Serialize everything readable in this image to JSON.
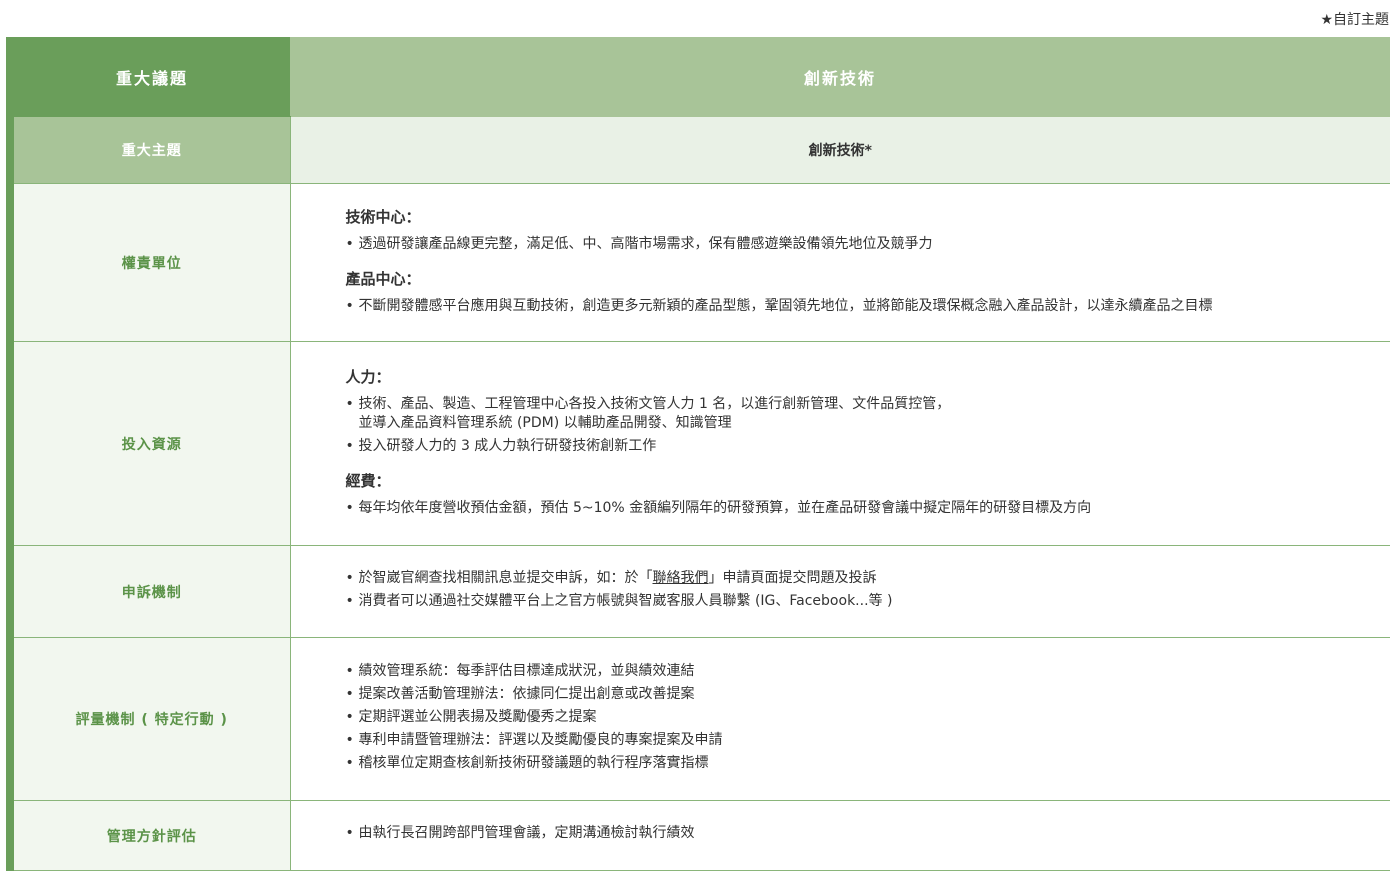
{
  "note": "★自訂主題",
  "header": {
    "left": "重大議題",
    "right": "創新技術"
  },
  "topic": {
    "left": "重大主題",
    "right": "創新技術*"
  },
  "responsible": {
    "label": "權責單位",
    "groups": [
      {
        "title": "技術中心：",
        "items": [
          "透過研發讓產品線更完整，滿足低、中、高階市場需求，保有體感遊樂設備領先地位及競爭力"
        ]
      },
      {
        "title": "產品中心：",
        "items": [
          "不斷開發體感平台應用與互動技術，創造更多元新穎的產品型態，鞏固領先地位，並將節能及環保概念融入產品設計，以達永續產品之目標"
        ]
      }
    ]
  },
  "investment": {
    "label": "投入資源",
    "groups": [
      {
        "title": "人力：",
        "items": [
          "技術、產品、製造、工程管理中心各投入技術文管人力 1 名，以進行創新管理、文件品質控管，",
          "並導入產品資料管理系統 (PDM) 以輔助產品開發、知識管理",
          "投入研發人力的 3 成人力執行研發技術創新工作"
        ]
      },
      {
        "title": "經費：",
        "items": [
          "每年均依年度營收預估金額，預估 5~10% 金額編列隔年的研發預算，並在產品研發會議中擬定隔年的研發目標及方向"
        ]
      }
    ]
  },
  "appeal": {
    "label": "申訴機制",
    "item1_prefix": "於智崴官網查找相關訊息並提交申訴，如：於「",
    "item1_link": "聯絡我們",
    "item1_suffix": "」申請頁面提交問題及投訴",
    "item2": "消費者可以通過社交媒體平台上之官方帳號與智崴客服人員聯繫 (IG、Facebook...等 )"
  },
  "evaluation": {
    "label": "評量機制 ( 特定行動 )",
    "items": [
      "績效管理系統：每季評估目標達成狀況，並與績效連結",
      "提案改善活動管理辦法：依據同仁提出創意或改善提案",
      "定期評選並公開表揚及獎勵優秀之提案",
      "專利申請暨管理辦法：評選以及獎勵優良的專案提案及申請",
      "稽核單位定期查核創新技術研發議題的執行程序落實指標"
    ]
  },
  "assessment": {
    "label": "管理方針評估",
    "items": [
      "由執行長召開跨部門管理會議，定期溝通檢討執行績效"
    ]
  }
}
